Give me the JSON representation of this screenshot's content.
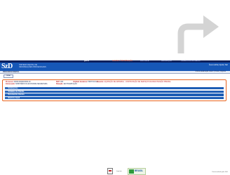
{
  "topbar": {
    "brand": "gov.br",
    "highlight": "ACESSO À INFORMAÇÃO",
    "links": [
      "PARTICIPE",
      "LEGISLAÇÃO",
      "ÓRGÃOS DO GOVERNO"
    ]
  },
  "header": {
    "logo": "SzD",
    "subtitle_1": "SISTEMA DIGITAL DE",
    "subtitle_2": "INFORMAÇÕES PROCESSUAIS",
    "right_links": "Área restrita  |  Ajuda  |  Sair"
  },
  "subheader": {
    "title": "PROCESSO DIGITAL",
    "right": "Ultima atualização ontem  |  Portal  |  Opções"
  },
  "back_button": "Voltar",
  "process": {
    "processo_label": "Processo:",
    "processo_value": "00000.000000/0000-00",
    "interessado_label": "Interessado:",
    "interessado_value": "MINISTÉRIO DA ECONOMIA SECRETARIA",
    "nup_label": "NUP:",
    "nup_value": "000",
    "unidade_label": "Unidade Geradora:",
    "unidade_value": "PROTOCOLO",
    "situacao_label": "Situação:",
    "situacao_value": "EM TRAMITAÇÃO",
    "assunto_label": "Assunto:",
    "assunto_value": "AQUISIÇÃO DE MATERIAL - CONTRATAÇÃO DE SERVIÇOS DE MANUTENÇÃO PREDIAL"
  },
  "sections": [
    {
      "label": "Andamentos"
    },
    {
      "label": "Unidades de Trâmite"
    },
    {
      "label": "Documentos Anexos"
    },
    {
      "label": "Histórico Geral"
    }
  ],
  "footer": {
    "small": "Imprimir",
    "brasil": "BRASIL",
    "right": "Desenvolvido pelo SzD"
  },
  "colors": {
    "header_blue": "#1657b7",
    "topbar": "#0d1f5c",
    "highlight_orange": "#e8641e",
    "section_blue": "#1e5eb5"
  }
}
